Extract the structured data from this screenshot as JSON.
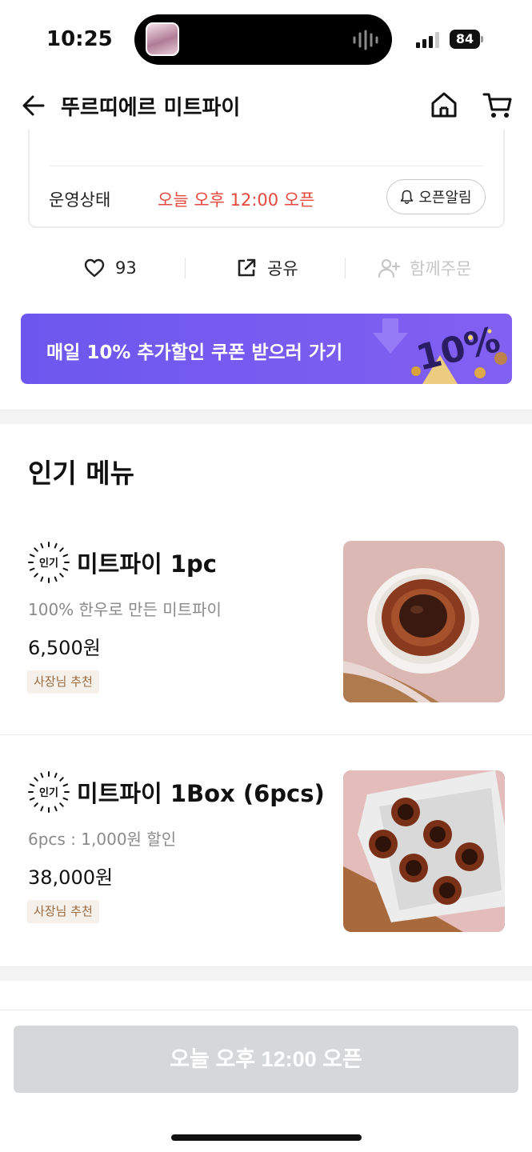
{
  "status_bar": {
    "time": "10:25",
    "battery": "84"
  },
  "header": {
    "title": "뚜르띠에르 미트파이"
  },
  "store_info": {
    "operation_label": "운영상태",
    "operation_value": "오늘 오후 12:00 오픈",
    "alarm_button_label": "오픈알림"
  },
  "actions": {
    "like_count": "93",
    "share_label": "공유",
    "group_order_label": "함께주문"
  },
  "banner": {
    "text": "매일 10% 추가할인 쿠폰 받으러 가기",
    "badge_text": "10%"
  },
  "popular_menu": {
    "title": "인기 메뉴",
    "badge_label": "인기",
    "items": [
      {
        "name": "미트파이 1pc",
        "description": "100% 한우로 만든 미트파이",
        "price": "6,500원",
        "tag": "사장님 추천"
      },
      {
        "name": "미트파이 1Box (6pcs)",
        "description": "6pcs : 1,000원 할인",
        "price": "38,000원",
        "tag": "사장님 추천"
      }
    ]
  },
  "bottom_button": {
    "label": "오늘 오후 12:00 오픈"
  },
  "colors": {
    "banner": "#6c57ee",
    "open_status": "#e5483c",
    "tag_text": "#9a6a41",
    "disabled_button": "#d6d7d9"
  }
}
